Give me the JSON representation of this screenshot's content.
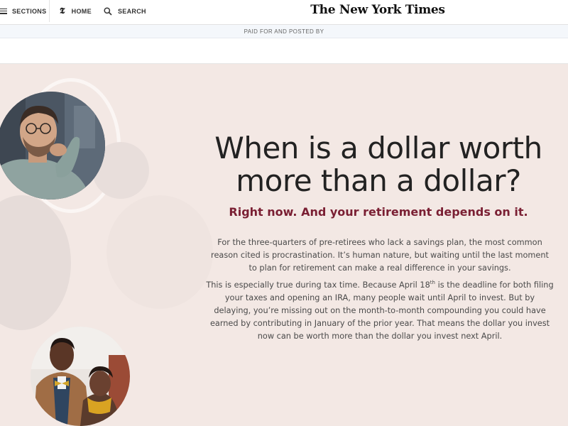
{
  "nav": {
    "sections_label": "SECTIONS",
    "home_label": "HOME",
    "home_icon_glyph": "𝕿",
    "search_label": "SEARCH",
    "masthead": "The New York Times"
  },
  "ad": {
    "paid_label": "PAID FOR AND POSTED BY"
  },
  "hero": {
    "headline": "When is a dollar worth more than a dollar?",
    "subhead": "Right now. And your retirement depends on it.",
    "paragraph1": "For the three-quarters of pre-retirees who lack a savings plan, the most common reason cited is procrastination. It’s human nature, but waiting until the last moment to plan for retirement can make a real difference in your savings.",
    "paragraph2_before": "This is especially true during tax time. Because April 18",
    "paragraph2_sup": "th",
    "paragraph2_after": " is the deadline for both filing your taxes and opening an IRA, many people wait until April to invest. But by delaying, you’re missing out on the month-to-month compounding you could have earned by contributing in January of the prior year. That means the dollar you invest now can be worth more than the dollar you invest next April."
  },
  "colors": {
    "hero_background": "#f3e8e4",
    "subhead": "#7a1f33",
    "headline": "#222222",
    "body_text": "#4a4a4a"
  },
  "icons": [
    "hamburger-menu-icon",
    "nyt-t-logo-icon",
    "search-icon"
  ]
}
